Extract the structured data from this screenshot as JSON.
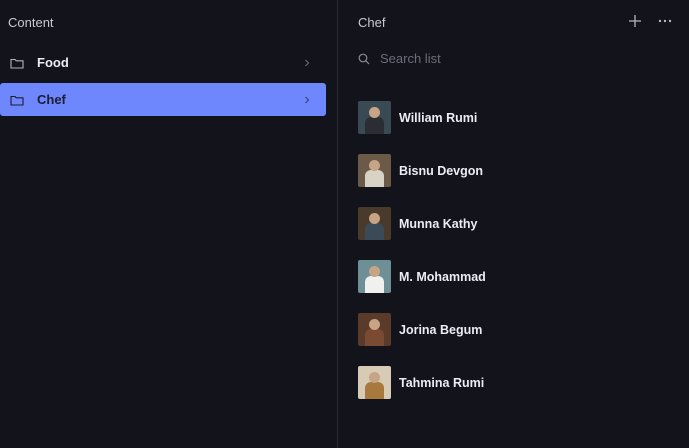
{
  "content_pane": {
    "title": "Content",
    "items": [
      {
        "label": "Food",
        "icon": "folder-icon",
        "active": false
      },
      {
        "label": "Chef",
        "icon": "folder-icon",
        "active": true
      }
    ]
  },
  "list_pane": {
    "title": "Chef",
    "add_icon": "plus-icon",
    "menu_icon": "more-icon",
    "search": {
      "placeholder": "Search list",
      "value": ""
    },
    "items": [
      {
        "name": "William Rumi",
        "bg": "#3a4a55",
        "body": "#2b2d33"
      },
      {
        "name": "Bisnu Devgon",
        "bg": "#6b5a48",
        "body": "#d9d2c6"
      },
      {
        "name": "Munna Kathy",
        "bg": "#4a3a2c",
        "body": "#3b4a57"
      },
      {
        "name": "M. Mohammad",
        "bg": "#6e8f95",
        "body": "#f0f0ee"
      },
      {
        "name": "Jorina Begum",
        "bg": "#5a3a28",
        "body": "#7b4a33"
      },
      {
        "name": "Tahmina Rumi",
        "bg": "#d8cbb5",
        "body": "#a8793f"
      }
    ]
  },
  "colors": {
    "accent": "#6f87fd",
    "background": "#13131c"
  }
}
